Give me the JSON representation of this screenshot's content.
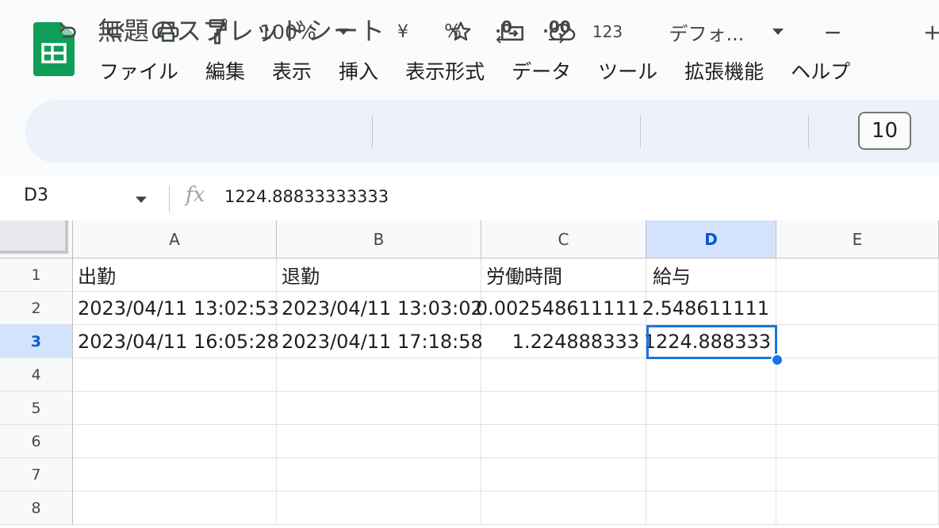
{
  "app": {
    "doc_title": "無題のスプレッドシート",
    "accent_color": "#1a73e8",
    "brand_color": "#0f9d58"
  },
  "title_icons": [
    "star-icon",
    "move-to-folder-icon",
    "cloud-saved-icon"
  ],
  "menu": [
    "ファイル",
    "編集",
    "表示",
    "挿入",
    "表示形式",
    "データ",
    "ツール",
    "拡張機能",
    "ヘルプ"
  ],
  "toolbar": {
    "undo_icon": "undo-icon",
    "redo_icon": "redo-icon",
    "print_icon": "print-icon",
    "paint_format_icon": "paint-format-icon",
    "zoom": "100%",
    "currency": "¥",
    "percent": "%",
    "decrease_decimal": ".0",
    "increase_decimal": ".00",
    "more_formats": "123",
    "font": "デフォ...",
    "font_size_minus": "−",
    "font_size": "10",
    "font_size_plus": "+"
  },
  "formula_bar": {
    "name_box": "D3",
    "fx": "fx",
    "value": "1224.88833333333"
  },
  "sheet": {
    "columns": [
      "A",
      "B",
      "C",
      "D",
      "E"
    ],
    "active_column": "D",
    "active_row": "3",
    "rows": [
      {
        "num": "1",
        "cells": [
          "出勤",
          "退勤",
          "労働時間",
          "給与",
          ""
        ]
      },
      {
        "num": "2",
        "cells": [
          "2023/04/11 13:02:53",
          "2023/04/11 13:03:02",
          "0.002548611111",
          "2.548611111",
          ""
        ]
      },
      {
        "num": "3",
        "cells": [
          "2023/04/11 16:05:28",
          "2023/04/11 17:18:58",
          "1.224888333",
          "1224.888333",
          ""
        ]
      },
      {
        "num": "4",
        "cells": [
          "",
          "",
          "",
          "",
          ""
        ]
      },
      {
        "num": "5",
        "cells": [
          "",
          "",
          "",
          "",
          ""
        ]
      },
      {
        "num": "6",
        "cells": [
          "",
          "",
          "",
          "",
          ""
        ]
      },
      {
        "num": "7",
        "cells": [
          "",
          "",
          "",
          "",
          ""
        ]
      },
      {
        "num": "8",
        "cells": [
          "",
          "",
          "",
          "",
          ""
        ]
      }
    ]
  }
}
